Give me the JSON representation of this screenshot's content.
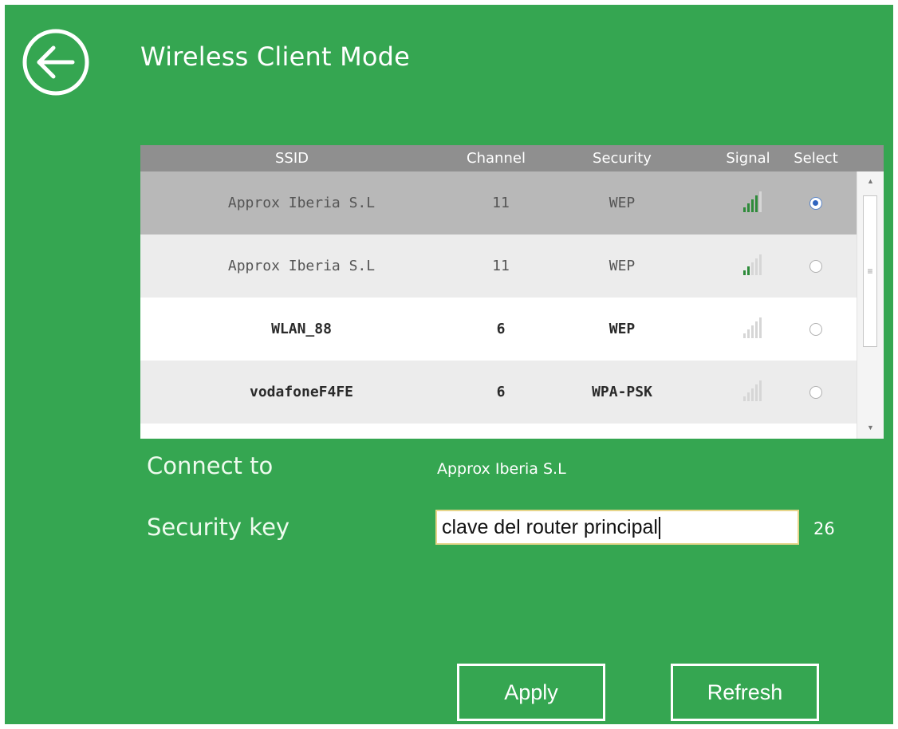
{
  "header": {
    "title": "Wireless Client Mode",
    "back_icon": "arrow-left-circle-icon"
  },
  "colors": {
    "background": "#35a651",
    "table_header": "#8f8f8f",
    "selected_row": "#b8b8b8",
    "alt_row": "#ececec",
    "white_row": "#ffffff",
    "signal_bar_active": "#2e8b3a",
    "signal_bar_inactive": "#d6d6d6"
  },
  "table": {
    "columns": [
      "SSID",
      "Channel",
      "Security",
      "Signal",
      "Select"
    ],
    "rows": [
      {
        "ssid": "Approx Iberia S.L",
        "channel": "11",
        "security": "WEP",
        "signal_bars": 4,
        "selected": true
      },
      {
        "ssid": "Approx Iberia S.L",
        "channel": "11",
        "security": "WEP",
        "signal_bars": 2,
        "selected": false
      },
      {
        "ssid": "WLAN_88",
        "channel": "6",
        "security": "WEP",
        "signal_bars": 0,
        "selected": false
      },
      {
        "ssid": "vodafoneF4FE",
        "channel": "6",
        "security": "WPA-PSK",
        "signal_bars": 0,
        "selected": false
      }
    ]
  },
  "form": {
    "connect_to_label": "Connect to",
    "connect_to_value": "Approx Iberia S.L",
    "security_key_label": "Security key",
    "security_key_value": "clave del router principal",
    "security_key_length": "26"
  },
  "buttons": {
    "apply": "Apply",
    "refresh": "Refresh"
  }
}
